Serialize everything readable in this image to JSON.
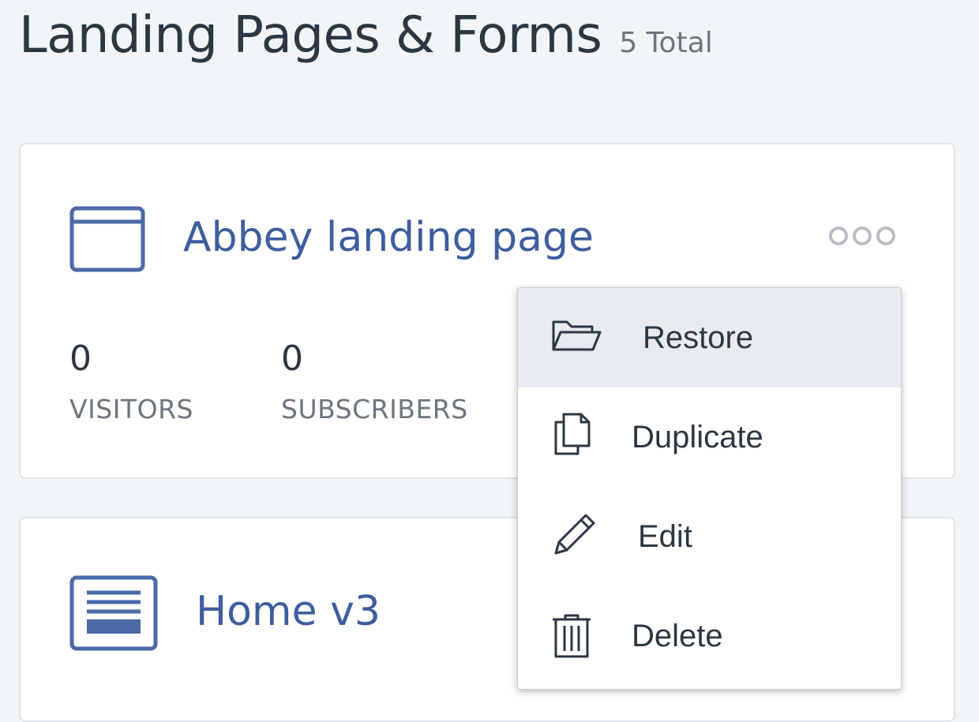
{
  "header": {
    "title": "Landing Pages & Forms",
    "count": "5 Total"
  },
  "cards": [
    {
      "title": "Abbey landing page",
      "icon": "browser-window-icon",
      "stats": [
        {
          "value": "0",
          "label": "VISITORS"
        },
        {
          "value": "0",
          "label": "SUBSCRIBERS"
        }
      ]
    },
    {
      "title": "Home v3",
      "icon": "page-layout-icon"
    }
  ],
  "menu": {
    "items": [
      {
        "label": "Restore",
        "icon": "folder-open-icon"
      },
      {
        "label": "Duplicate",
        "icon": "duplicate-icon"
      },
      {
        "label": "Edit",
        "icon": "pencil-icon"
      },
      {
        "label": "Delete",
        "icon": "trash-icon"
      }
    ]
  },
  "colors": {
    "accent": "#3e5e9e",
    "text": "#2c3744",
    "muted": "#6c7680",
    "background": "#f2f5f8",
    "menu_highlight": "#e8ebef"
  }
}
